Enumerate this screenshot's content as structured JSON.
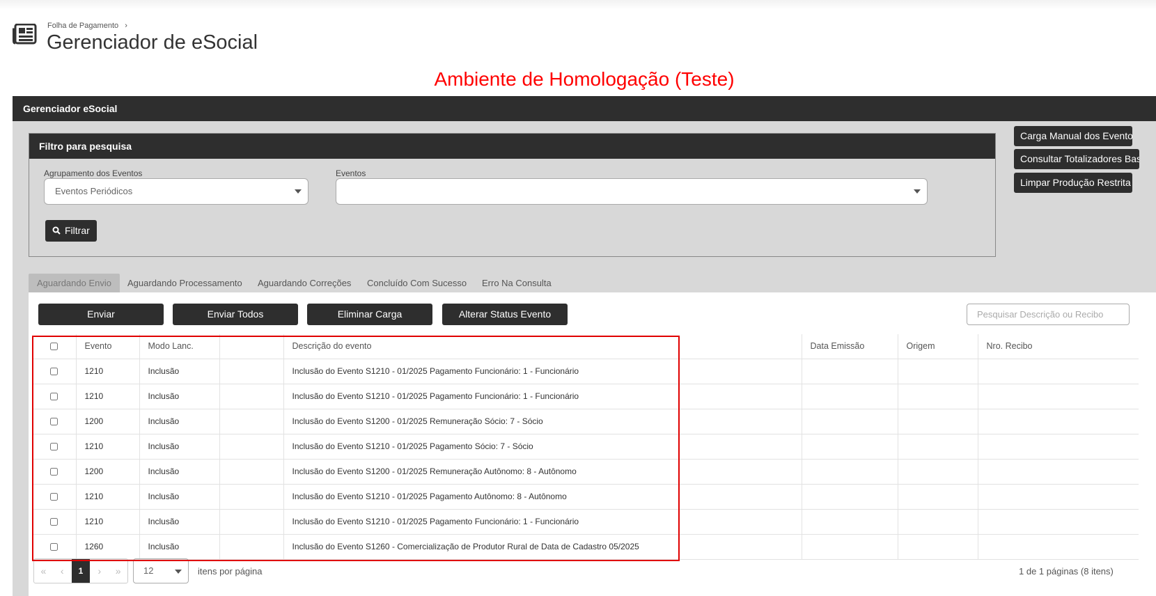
{
  "breadcrumb": {
    "parent": "Folha de Pagamento"
  },
  "page_title": "Gerenciador de eSocial",
  "environment_banner": "Ambiente de Homologação (Teste)",
  "panel_title": "Gerenciador eSocial",
  "filter": {
    "title": "Filtro para pesquisa",
    "grouping_label": "Agrupamento dos Eventos",
    "grouping_value": "Eventos Periódicos",
    "events_label": "Eventos",
    "events_value": "",
    "filter_button": "Filtrar"
  },
  "side_buttons": {
    "manual_load": "Carga Manual dos Eventos",
    "totals": "Consultar Totalizadores Base",
    "clear_restricted": "Limpar Produção Restrita"
  },
  "tabs": [
    {
      "label": "Aguardando Envio",
      "active": true
    },
    {
      "label": "Aguardando Processamento",
      "active": false
    },
    {
      "label": "Aguardando Correções",
      "active": false
    },
    {
      "label": "Concluído Com Sucesso",
      "active": false
    },
    {
      "label": "Erro Na Consulta",
      "active": false
    }
  ],
  "actions": {
    "send": "Enviar",
    "send_all": "Enviar Todos",
    "delete_load": "Eliminar Carga",
    "change_status": "Alterar Status Evento",
    "search_placeholder": "Pesquisar Descrição ou Recibo"
  },
  "table": {
    "columns": [
      "Evento",
      "Modo Lanc.",
      "",
      "Descrição do evento",
      "Data Emissão",
      "Origem",
      "Nro. Recibo"
    ],
    "rows": [
      [
        "1210",
        "Inclusão",
        "",
        "Inclusão do Evento S1210 - 01/2025 Pagamento Funcionário: 1 - Funcionário",
        "",
        "",
        ""
      ],
      [
        "1210",
        "Inclusão",
        "",
        "Inclusão do Evento S1210 - 01/2025 Pagamento Funcionário: 1 - Funcionário",
        "",
        "",
        ""
      ],
      [
        "1200",
        "Inclusão",
        "",
        "Inclusão do Evento S1200 - 01/2025 Remuneração Sócio: 7 - Sócio",
        "",
        "",
        ""
      ],
      [
        "1210",
        "Inclusão",
        "",
        "Inclusão do Evento S1210 - 01/2025 Pagamento Sócio: 7 - Sócio",
        "",
        "",
        ""
      ],
      [
        "1200",
        "Inclusão",
        "",
        "Inclusão do Evento S1200 - 01/2025 Remuneração Autônomo: 8 - Autônomo",
        "",
        "",
        ""
      ],
      [
        "1210",
        "Inclusão",
        "",
        "Inclusão do Evento S1210 - 01/2025 Pagamento Autônomo: 8 - Autônomo",
        "",
        "",
        ""
      ],
      [
        "1210",
        "Inclusão",
        "",
        "Inclusão do Evento S1210 - 01/2025 Pagamento Funcionário: 1 - Funcionário",
        "",
        "",
        ""
      ],
      [
        "1260",
        "Inclusão",
        "",
        "Inclusão do Evento S1260 - Comercialização de Produtor Rural de Data de Cadastro 05/2025",
        "",
        "",
        ""
      ]
    ]
  },
  "pagination": {
    "first": "«",
    "prev": "‹",
    "current_page": "1",
    "next": "›",
    "last": "»",
    "per_page": "12",
    "per_page_label": "itens por página",
    "info": "1 de 1 páginas (8 itens)"
  },
  "colors": {
    "dark_header": "#2e2e2e",
    "panel_bg": "#d8d8d8",
    "banner_text": "#ff0000",
    "highlight_border": "#e00000"
  },
  "icons": {
    "page": "newspaper-icon",
    "breadcrumb_separator": "chevron-right-icon",
    "filter_button": "search-icon"
  }
}
